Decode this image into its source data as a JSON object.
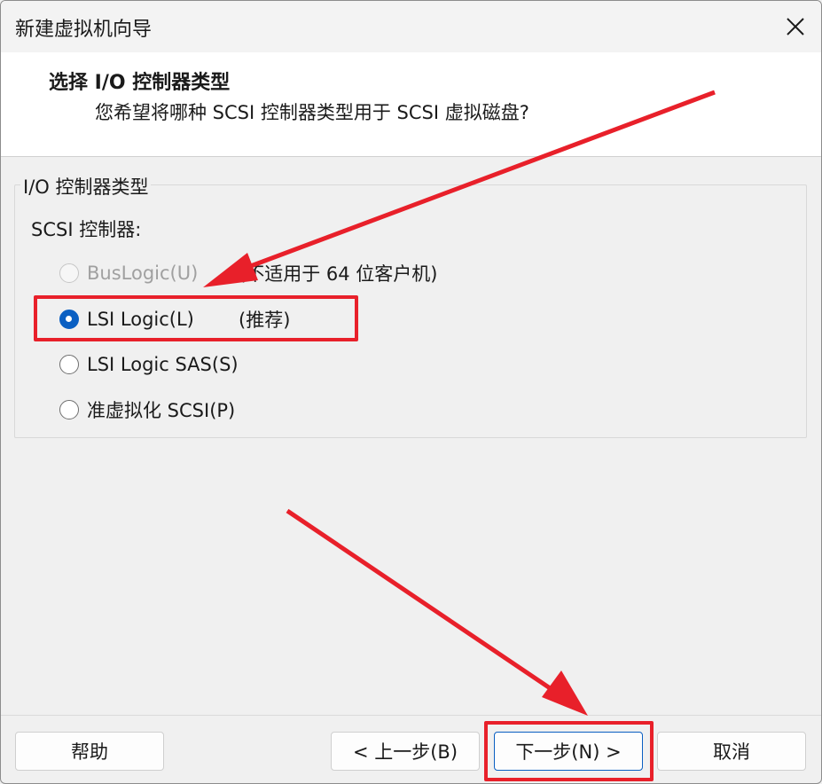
{
  "window": {
    "title": "新建虚拟机向导"
  },
  "header": {
    "title": "选择 I/O 控制器类型",
    "subtitle": "您希望将哪种 SCSI 控制器类型用于 SCSI 虚拟磁盘?"
  },
  "group": {
    "legend": "I/O 控制器类型",
    "scsi_label": "SCSI 控制器:",
    "options": [
      {
        "label": "BusLogic(U)",
        "note": "(不适用于 64 位客户机)",
        "checked": false,
        "disabled": true
      },
      {
        "label": "LSI Logic(L)",
        "note": "(推荐)",
        "checked": true,
        "disabled": false
      },
      {
        "label": "LSI Logic SAS(S)",
        "note": "",
        "checked": false,
        "disabled": false
      },
      {
        "label": "准虚拟化 SCSI(P)",
        "note": "",
        "checked": false,
        "disabled": false
      }
    ]
  },
  "footer": {
    "help": "帮助",
    "back": "< 上一步(B)",
    "next": "下一步(N) >",
    "cancel": "取消"
  },
  "colors": {
    "accent": "#0a5fc2",
    "highlight": "#e8202a"
  },
  "icons": {
    "close": "close-icon",
    "annotation": "red-arrow-annotation"
  }
}
